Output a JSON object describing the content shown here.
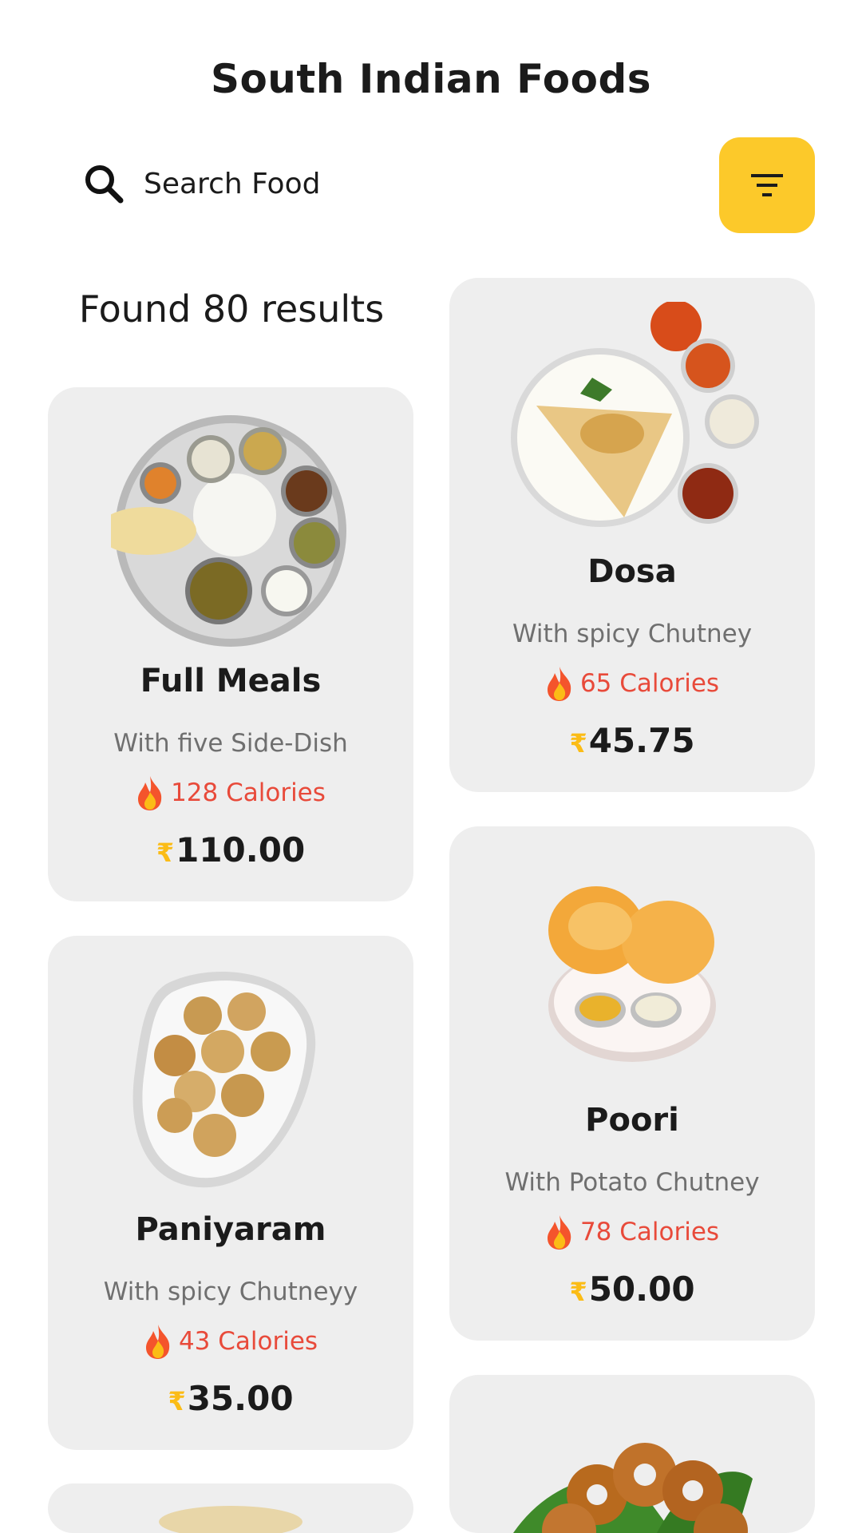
{
  "header": {
    "title": "South Indian Foods"
  },
  "search": {
    "placeholder": "Search Food"
  },
  "results": {
    "label": "Found 80 results"
  },
  "colors": {
    "accent": "#fcc92a",
    "calorie": "#e84a3a",
    "card": "#eeeeee",
    "muted": "#6f6f6f"
  },
  "currency_symbol": "₹",
  "foods": [
    {
      "name": "Full Meals",
      "desc": "With five Side-Dish",
      "calories": "128 Calories",
      "price": "110.00"
    },
    {
      "name": "Dosa",
      "desc": "With spicy Chutney",
      "calories": "65 Calories",
      "price": "45.75"
    },
    {
      "name": "Paniyaram",
      "desc": "With spicy Chutneyy",
      "calories": "43 Calories",
      "price": "35.00"
    },
    {
      "name": "Poori",
      "desc": "With Potato Chutney",
      "calories": "78 Calories",
      "price": "50.00"
    }
  ]
}
